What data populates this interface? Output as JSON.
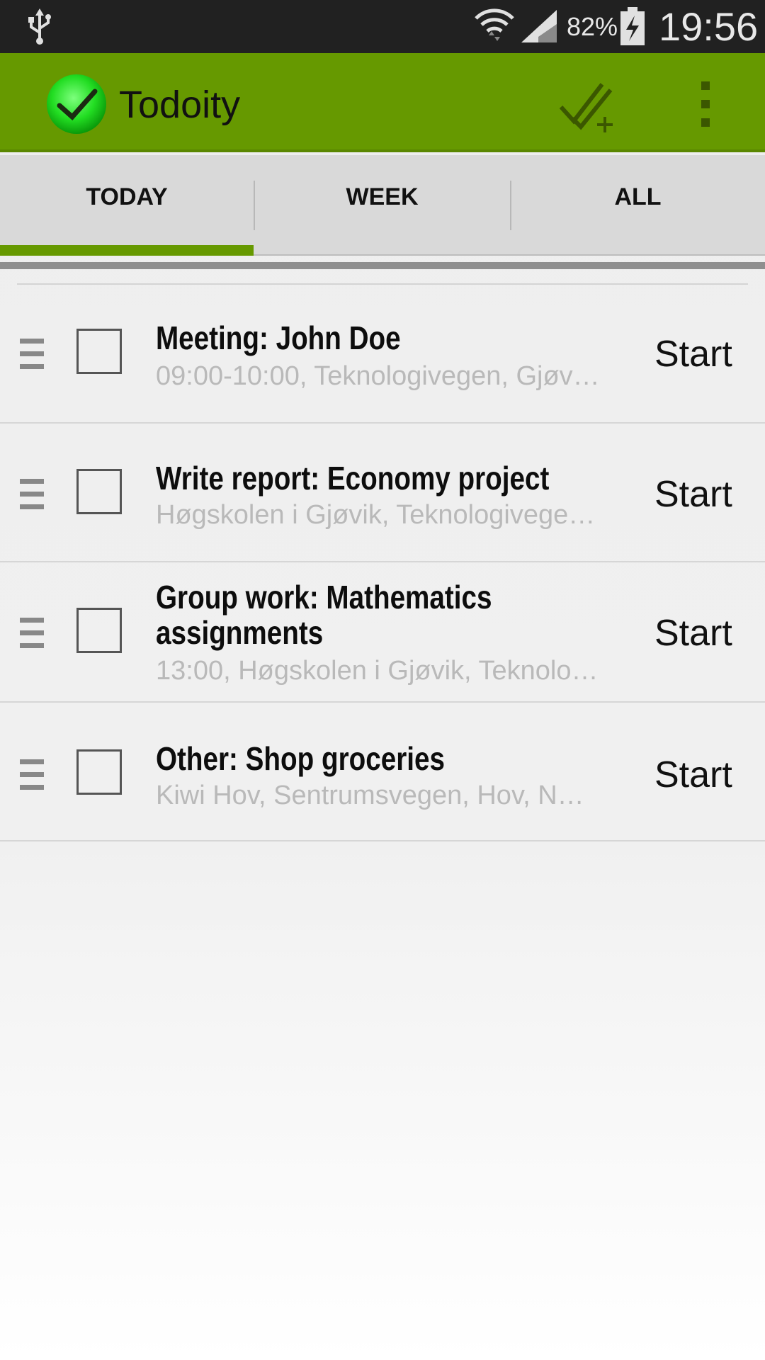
{
  "status_bar": {
    "battery_percent": "82%",
    "time": "19:56",
    "icons": [
      "usb-icon",
      "wifi-icon",
      "signal-icon",
      "battery-charging-icon"
    ]
  },
  "action_bar": {
    "title": "Todoity",
    "logo_icon": "check-circle-icon",
    "actions": [
      "add-task-icon",
      "overflow-menu-icon"
    ],
    "color": "#669900"
  },
  "tabs": [
    {
      "label": "TODAY",
      "selected": true
    },
    {
      "label": "WEEK",
      "selected": false
    },
    {
      "label": "ALL",
      "selected": false
    }
  ],
  "tasks": [
    {
      "title": "Meeting: John Doe",
      "subtitle": "09:00-10:00, Teknologivegen, Gjøv…",
      "action": "Start",
      "checked": false
    },
    {
      "title": "Write report: Economy project",
      "subtitle": "Høgskolen i Gjøvik, Teknologivege…",
      "action": "Start",
      "checked": false
    },
    {
      "title": "Group work: Mathematics assignments",
      "subtitle": "13:00, Høgskolen i Gjøvik, Teknolo…",
      "action": "Start",
      "checked": false
    },
    {
      "title": "Other: Shop groceries",
      "subtitle": "Kiwi Hov, Sentrumsvegen, Hov, N…",
      "action": "Start",
      "checked": false
    }
  ]
}
